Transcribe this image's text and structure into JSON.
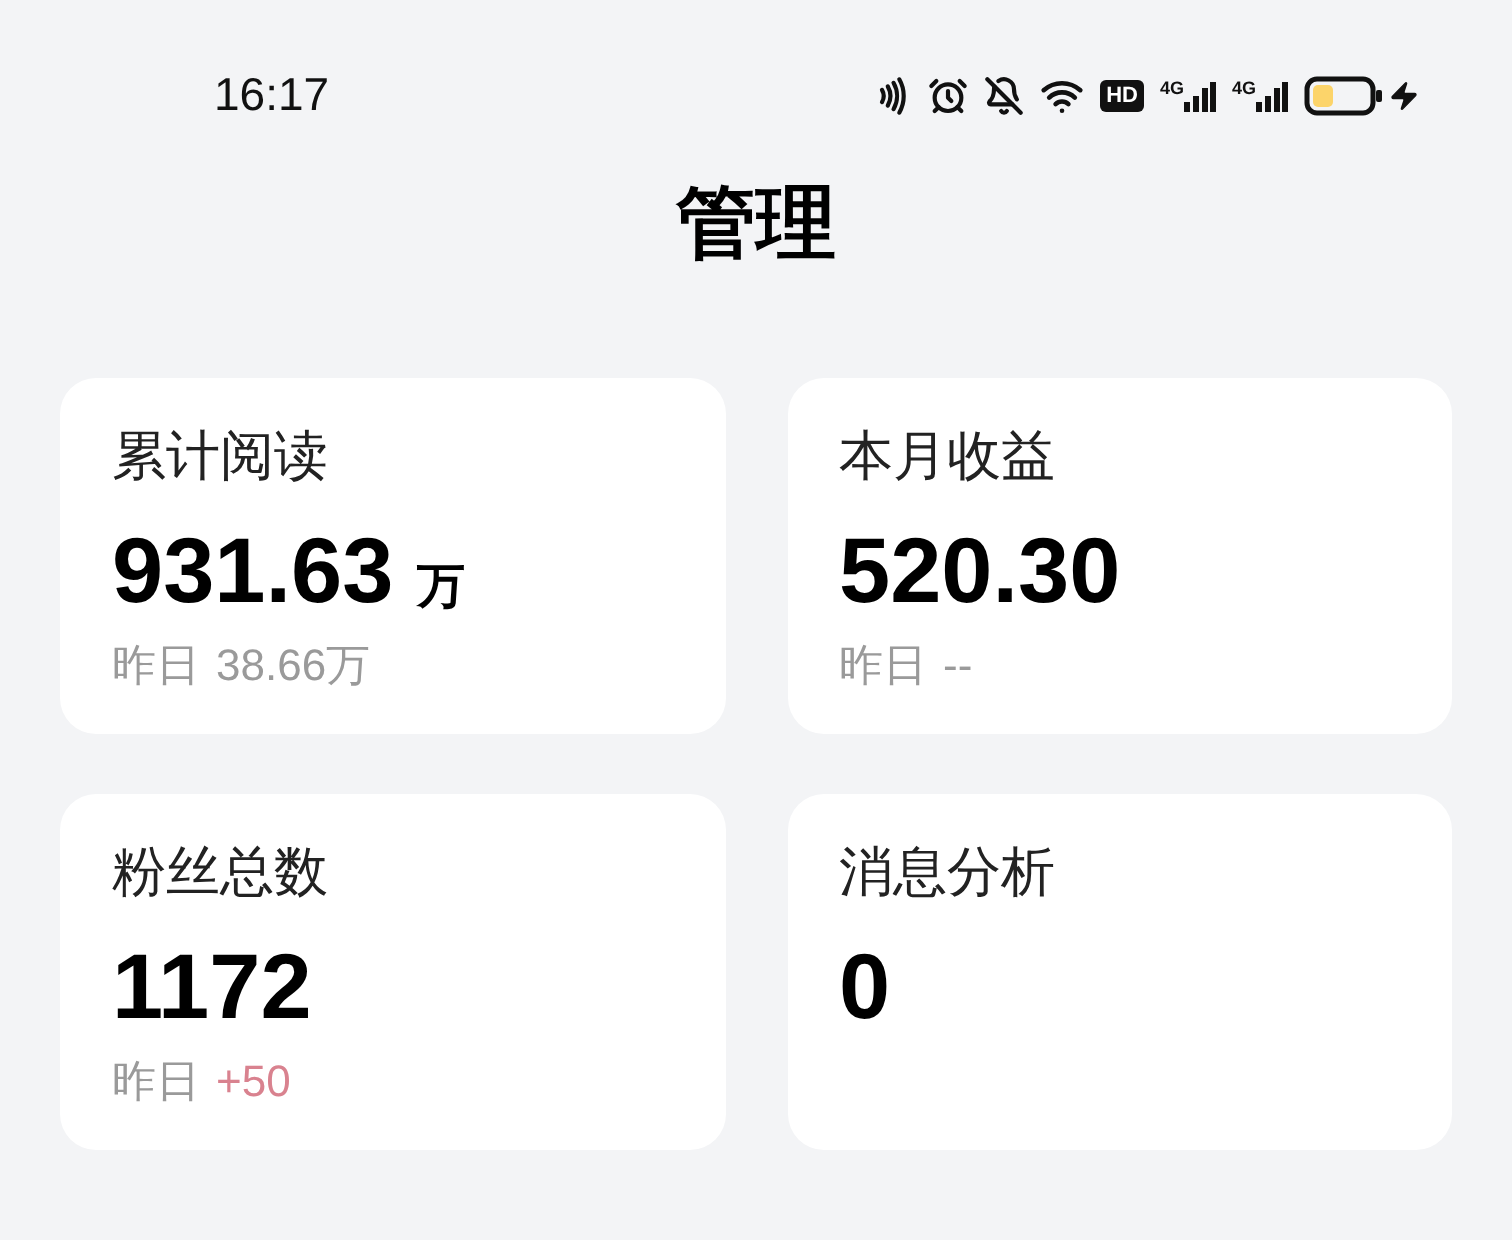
{
  "status_bar": {
    "time": "16:17",
    "hd_badge": "HD",
    "networks": [
      "4G",
      "4G"
    ]
  },
  "title": "管理",
  "cards": [
    {
      "label": "累计阅读",
      "value": "931.63",
      "unit": "万",
      "yesterday_label": "昨日",
      "yesterday_value": "38.66万",
      "color": "#9a9a9a"
    },
    {
      "label": "本月收益",
      "value": "520.30",
      "yesterday_label": "昨日",
      "yesterday_value": "--",
      "color": "#9a9a9a"
    },
    {
      "label": "粉丝总数",
      "value": "1172",
      "yesterday_label": "昨日",
      "yesterday_value": "+50",
      "color": "#d9828f"
    },
    {
      "label": "消息分析",
      "value": "0"
    }
  ]
}
